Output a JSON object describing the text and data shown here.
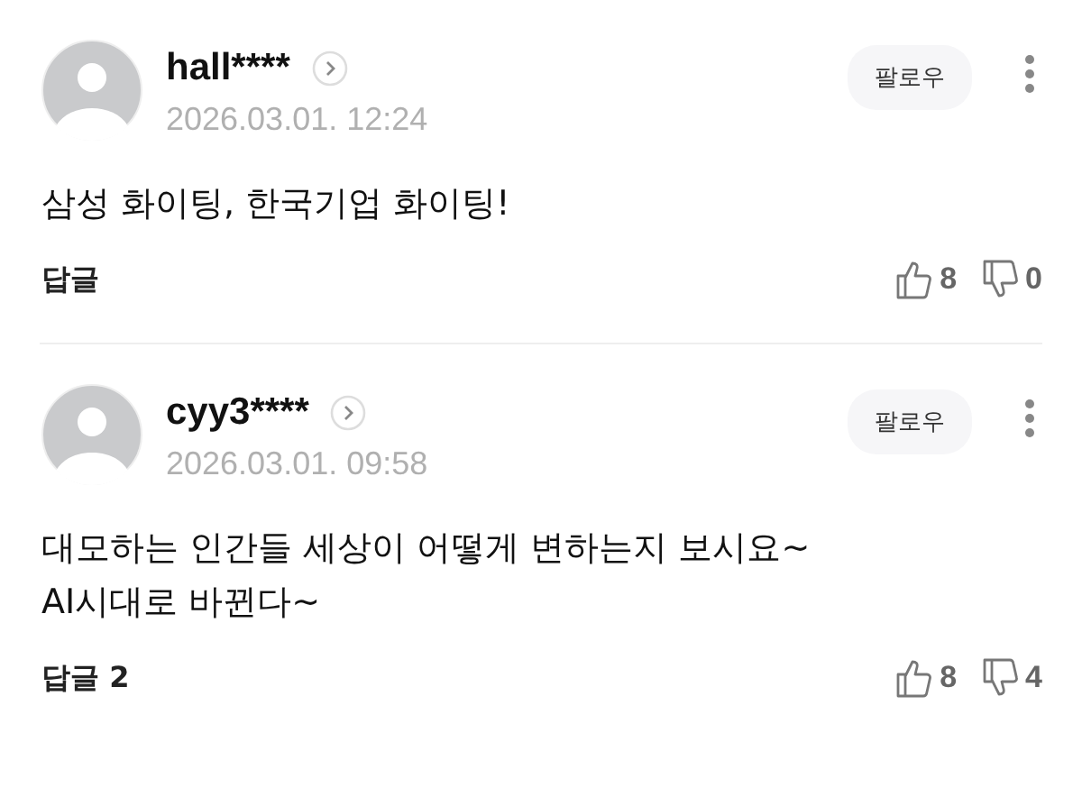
{
  "comments": [
    {
      "author": "hall****",
      "date": "2026.03.01. 12:24",
      "follow": "팔로우",
      "lines": [
        "삼성 화이팅, 한국기업 화이팅!"
      ],
      "reply": "답글",
      "likes": "8",
      "dislikes": "0"
    },
    {
      "author": "cyy3****",
      "date": "2026.03.01. 09:58",
      "follow": "팔로우",
      "lines": [
        "대모하는 인간들 세상이 어떻게 변하는지 보시요~",
        "AI시대로 바뀐다~"
      ],
      "reply": "답글 2",
      "likes": "8",
      "dislikes": "4"
    }
  ]
}
